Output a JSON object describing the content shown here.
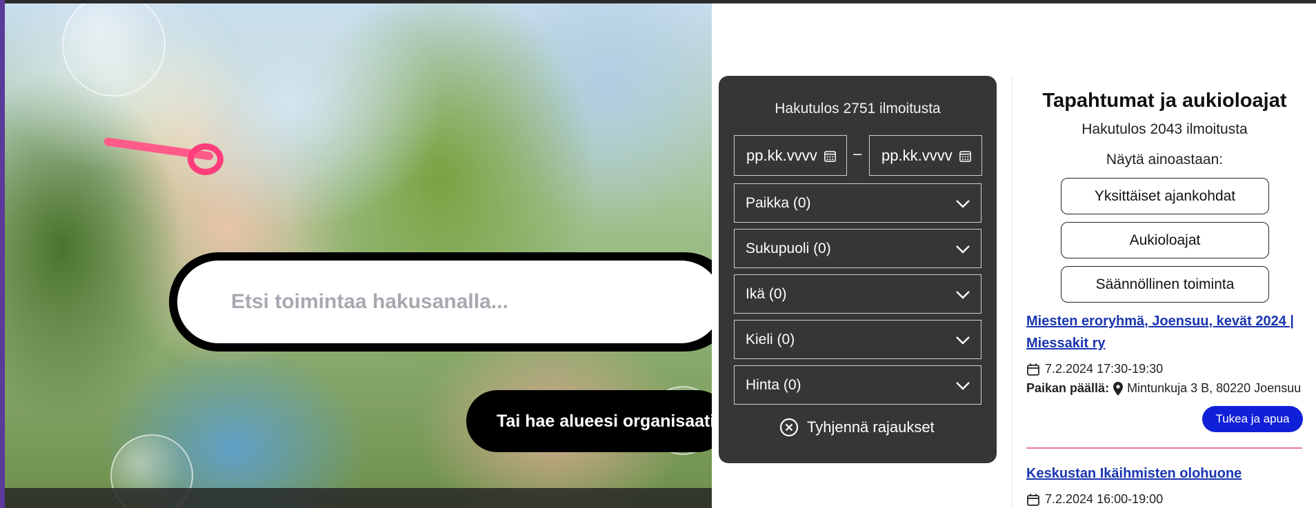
{
  "search": {
    "placeholder": "Etsi toimintaa hakusanalla...",
    "organization_button": "Tai hae alueesi organisaatioita"
  },
  "filters": {
    "result_count": "Hakutulos 2751 ilmoitusta",
    "date_start_placeholder": "pp.kk.vvvv",
    "date_end_placeholder": "pp.kk.vvvv",
    "date_separator": "–",
    "dropdowns": [
      {
        "label": "Paikka (0)"
      },
      {
        "label": "Sukupuoli (0)"
      },
      {
        "label": "Ikä (0)"
      },
      {
        "label": "Kieli (0)"
      },
      {
        "label": "Hinta (0)"
      }
    ],
    "clear_label": "Tyhjennä rajaukset"
  },
  "results": {
    "title": "Tapahtumat ja aukioloajat",
    "count": "Hakutulos 2043 ilmoitusta",
    "show_only": "Näytä ainoastaan:",
    "type_buttons": [
      {
        "label": "Yksittäiset ajankohdat"
      },
      {
        "label": "Aukioloajat"
      },
      {
        "label": "Säännöllinen toiminta"
      }
    ],
    "events": [
      {
        "title": "Miesten eroryhmä, Joensuu, kevät 2024 | Miessakit ry",
        "datetime": "7.2.2024 17:30-19:30",
        "location_label": "Paikan päällä:",
        "address": "Mintunkuja 3 B, 80220 Joensuu",
        "tag": "Tukea ja apua"
      },
      {
        "title": "Keskustan Ikäihmisten olohuone",
        "datetime": "7.2.2024 16:00-19:00"
      }
    ]
  },
  "colors": {
    "panel_dark": "#363636",
    "link_blue": "#1a35b0",
    "tag_blue": "#1020d8",
    "separator_pink": "#e8779f"
  }
}
